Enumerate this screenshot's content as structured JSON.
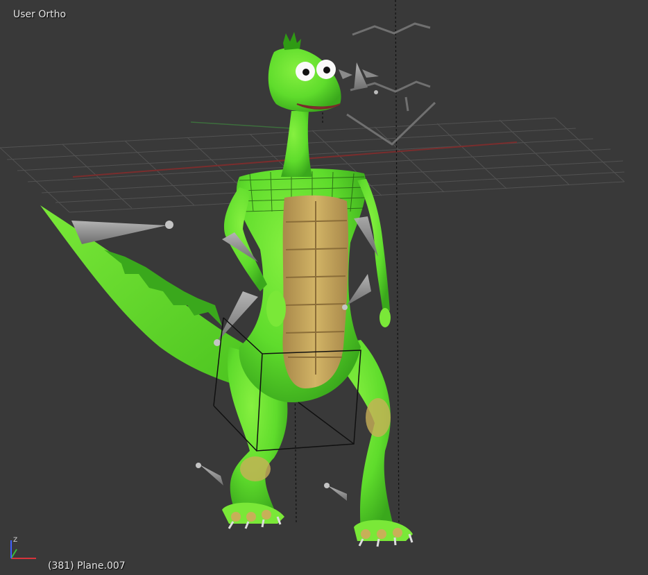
{
  "viewport": {
    "view_label": "User Ortho",
    "object_info": "(381) Plane.007",
    "background_color": "#393939"
  },
  "gizmo": {
    "icon": "axis-gizmo-icon",
    "z_label": "Z",
    "colors": {
      "x": "#d8343c",
      "y": "#3cbc3c",
      "z": "#4060ff"
    }
  },
  "scene": {
    "model": "green dinosaur character with armature bones",
    "colors": {
      "skin": "#5fdc2c",
      "skin_dark": "#3aa81c",
      "belly": "#c8a95a",
      "bone": "#9a9a9a",
      "grid": "#555555",
      "grid_x_axis": "#7a2d2d",
      "grid_y_axis": "#3d6e3d"
    }
  }
}
